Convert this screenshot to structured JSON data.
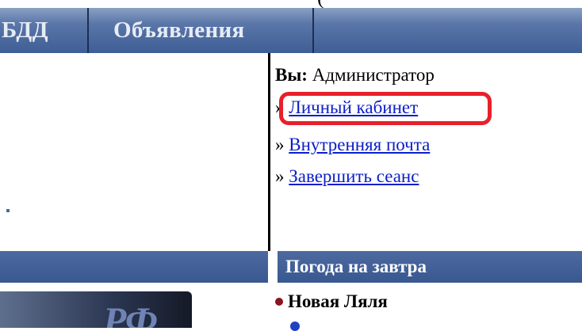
{
  "header": {
    "nav_items": [
      "БДД",
      "Объявления"
    ]
  },
  "user_panel": {
    "label": "Вы:",
    "role": "Администратор",
    "arrow": "»",
    "links": [
      "Личный кабинет",
      "Внутренняя почта",
      "Завершить сеанс"
    ]
  },
  "sidebar": {
    "weather_title": "Погода на завтра",
    "news_item": "Новая Ляля",
    "banner_text": "РФ"
  },
  "colors": {
    "nav": "#3e5e96",
    "link": "#0b1ec9",
    "highlight": "#e8202a"
  }
}
